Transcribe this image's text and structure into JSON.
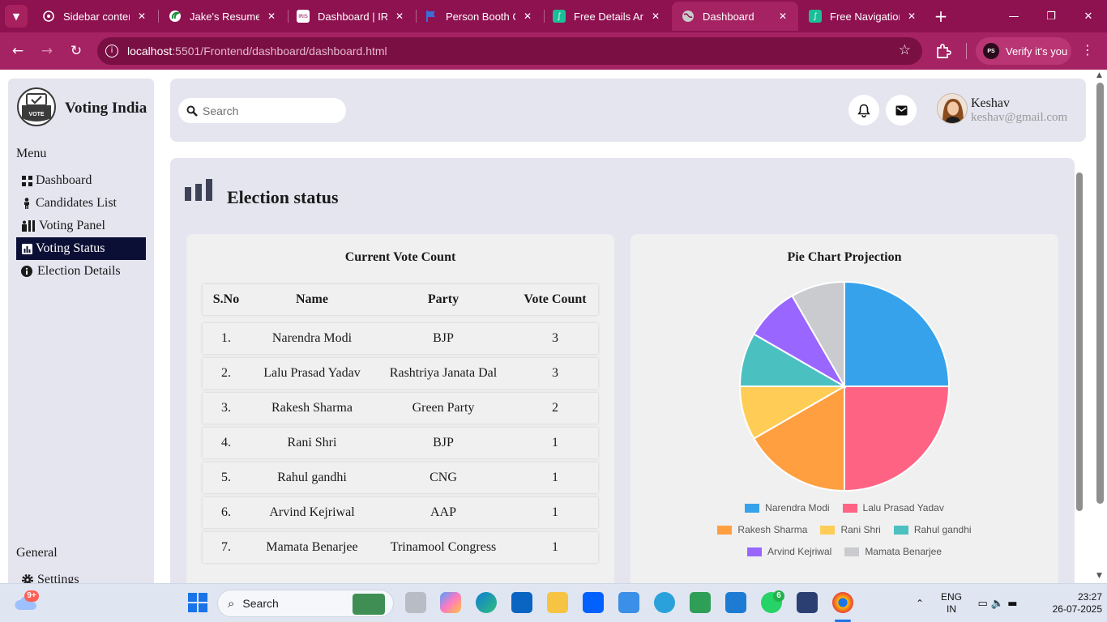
{
  "browser": {
    "tabs": [
      {
        "title": "Sidebar content",
        "favicon": "sidebar-favicon",
        "color": "#8e1150"
      },
      {
        "title": "Jake's Resume -",
        "favicon": "overleaf-favicon",
        "color": "#8e1150"
      },
      {
        "title": "Dashboard | IRIS",
        "favicon": "iris-favicon",
        "color": "#ffffff"
      },
      {
        "title": "Person Booth Cl",
        "favicon": "flag-favicon",
        "color": "#3b6fd8"
      },
      {
        "title": "Free Details Anim",
        "favicon": "animation-favicon",
        "color": "#1bbf97"
      },
      {
        "title": "Dashboard",
        "favicon": "globe-favicon",
        "color": "#c9c9c9"
      },
      {
        "title": "Free Navigation",
        "favicon": "animation-favicon",
        "color": "#1bbf97"
      }
    ],
    "active_tab": 5,
    "url_host": "localhost",
    "url_rest": ":5501/Frontend/dashboard/dashboard.html",
    "profile_label": "Verify it's you",
    "profile_initials": "PS"
  },
  "app": {
    "brand": "Voting India",
    "logo_text": "VOTE",
    "menu_heading": "Menu",
    "nav": [
      {
        "label": "Dashboard",
        "icon": "dashboard-icon"
      },
      {
        "label": "Candidates List",
        "icon": "person-icon"
      },
      {
        "label": "Voting Panel",
        "icon": "voting-panel-icon"
      },
      {
        "label": "Voting Status",
        "icon": "bar-chart-icon",
        "active": true
      },
      {
        "label": "Election Details",
        "icon": "info-icon"
      }
    ],
    "general_heading": "General",
    "general_nav": [
      {
        "label": "Settings",
        "icon": "gear-icon"
      }
    ]
  },
  "header": {
    "search_placeholder": "Search",
    "user_name": "Keshav",
    "user_email": "keshav@gmail.com"
  },
  "main": {
    "title": "Election status",
    "table_title": "Current Vote Count",
    "pie_title": "Pie Chart Projection",
    "columns": [
      "S.No",
      "Name",
      "Party",
      "Vote Count"
    ],
    "rows": [
      {
        "sno": "1.",
        "name": "Narendra Modi",
        "party": "BJP",
        "votes": "3"
      },
      {
        "sno": "2.",
        "name": "Lalu Prasad Yadav",
        "party": "Rashtriya Janata Dal",
        "votes": "3"
      },
      {
        "sno": "3.",
        "name": "Rakesh Sharma",
        "party": "Green Party",
        "votes": "2"
      },
      {
        "sno": "4.",
        "name": "Rani Shri",
        "party": "BJP",
        "votes": "1"
      },
      {
        "sno": "5.",
        "name": "Rahul gandhi",
        "party": "CNG",
        "votes": "1"
      },
      {
        "sno": "6.",
        "name": "Arvind Kejriwal",
        "party": "AAP",
        "votes": "1"
      },
      {
        "sno": "7.",
        "name": "Mamata Benarjee",
        "party": "Trinamool Congress",
        "votes": "1"
      }
    ]
  },
  "chart_data": {
    "type": "pie",
    "title": "Pie Chart Projection",
    "categories": [
      "Narendra Modi",
      "Lalu Prasad Yadav",
      "Rakesh Sharma",
      "Rani Shri",
      "Rahul gandhi",
      "Arvind Kejriwal",
      "Mamata Benarjee"
    ],
    "values": [
      3,
      3,
      2,
      1,
      1,
      1,
      1
    ],
    "colors": [
      "#36a2eb",
      "#ff6384",
      "#ff9f40",
      "#ffcd56",
      "#4bc0c0",
      "#9966ff",
      "#c9cbcf"
    ],
    "legend": "bottom"
  },
  "taskbar": {
    "search_label": "Search",
    "weather_badge": "9+",
    "whatsapp_badge": "6",
    "lang": "ENG",
    "region": "IN",
    "time": "23:27",
    "date": "26-07-2025"
  }
}
